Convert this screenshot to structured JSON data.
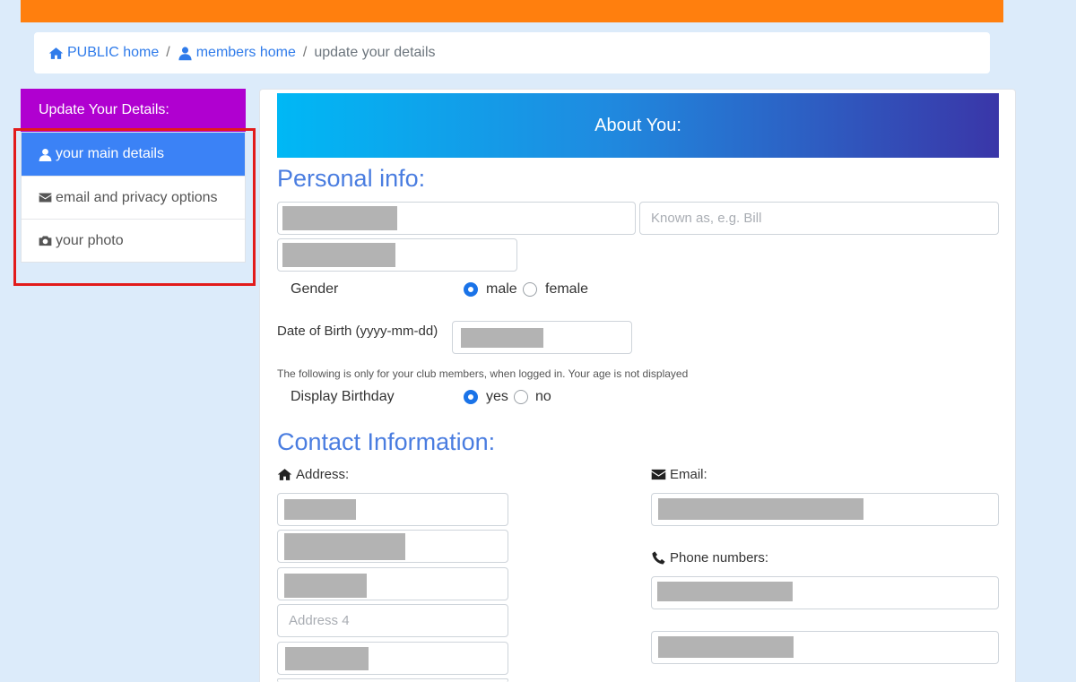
{
  "breadcrumb": {
    "public_home": "PUBLIC home",
    "members_home": "members home",
    "current": "update your details",
    "separator": "/"
  },
  "sidebar": {
    "header": "Update Your Details:",
    "items": [
      {
        "label": "your main details",
        "icon": "user-icon",
        "active": true
      },
      {
        "label": "email and privacy options",
        "icon": "envelope-icon",
        "active": false
      },
      {
        "label": "your photo",
        "icon": "camera-icon",
        "active": false
      }
    ]
  },
  "panel": {
    "header": "About You:"
  },
  "personal": {
    "title": "Personal info:",
    "known_as_placeholder": "Known as, e.g. Bill",
    "gender_label": "Gender",
    "gender_male": "male",
    "gender_female": "female",
    "gender_selected": "male",
    "dob_label": "Date of Birth (yyyy-mm-dd)",
    "note": "The following is only for your club members, when logged in. Your age is not displayed",
    "display_birthday_label": "Display Birthday",
    "birthday_yes": "yes",
    "birthday_no": "no",
    "birthday_selected": "yes"
  },
  "contact": {
    "title": "Contact Information:",
    "address_label": "Address:",
    "address4_placeholder": "Address 4",
    "email_label": "Email:",
    "phone_label": "Phone numbers:"
  },
  "colors": {
    "accent": "#3b82f6",
    "sidebar_header": "#b000d0",
    "banner": "#ff7f0e",
    "section_title": "#4a7de0"
  }
}
